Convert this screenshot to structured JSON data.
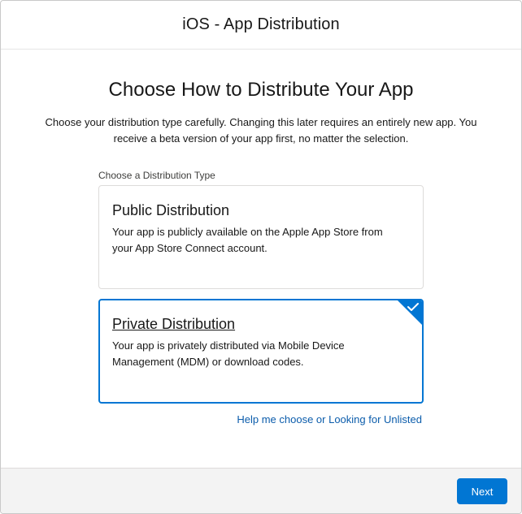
{
  "modal": {
    "title": "iOS - App Distribution"
  },
  "content": {
    "heading": "Choose How to Distribute Your App",
    "intro_line1": "Choose your distribution type carefully. Changing this later requires an entirely new app. You",
    "intro_line2": "receive a beta version of your app first, no matter the selection.",
    "group_label": "Choose a Distribution Type",
    "options": [
      {
        "title": "Public Distribution",
        "desc_line1": "Your app is publicly available on the Apple App Store from",
        "desc_line2": "your App Store Connect account.",
        "selected": false
      },
      {
        "title": "Private Distribution",
        "desc_line1": "Your app is privately distributed via Mobile Device",
        "desc_line2": "Management (MDM) or download codes.",
        "selected": true,
        "icon": "checkmark-icon"
      }
    ],
    "help_link": "Help me choose or Looking for Unlisted"
  },
  "footer": {
    "next_label": "Next"
  },
  "colors": {
    "brand": "#0176d3",
    "link": "#0b5cab",
    "footer_bg": "#f3f3f3"
  }
}
